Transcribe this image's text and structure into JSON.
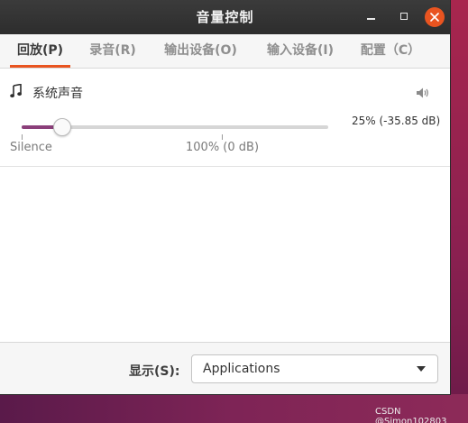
{
  "window": {
    "title": "音量控制",
    "controls": {
      "minimize": "minimize-icon",
      "maximize": "maximize-icon",
      "close": "close-icon"
    }
  },
  "tabs": [
    {
      "label": "回放(P)",
      "active": true
    },
    {
      "label": "录音(R)",
      "active": false
    },
    {
      "label": "输出设备(O)",
      "active": false
    },
    {
      "label": "输入设备(I)",
      "active": false
    },
    {
      "label": "配置（C）",
      "active": false
    }
  ],
  "stream": {
    "icon": "music-note-icon",
    "name": "系统声音",
    "mute_icon": "speaker-icon",
    "volume_text": "25% (-35.85 dB)",
    "volume_fraction": 0.1333,
    "marks": {
      "silence": "Silence",
      "hundred": "100% (0 dB)"
    }
  },
  "footer": {
    "show_label": "显示(S):",
    "show_value": "Applications",
    "dropdown_icon": "chevron-down-icon"
  },
  "watermark": "CSDN @Simon102803",
  "colors": {
    "accent": "#e95420",
    "slider_fill": "#8b3f7a",
    "titlebar": "#2d2d2d"
  }
}
